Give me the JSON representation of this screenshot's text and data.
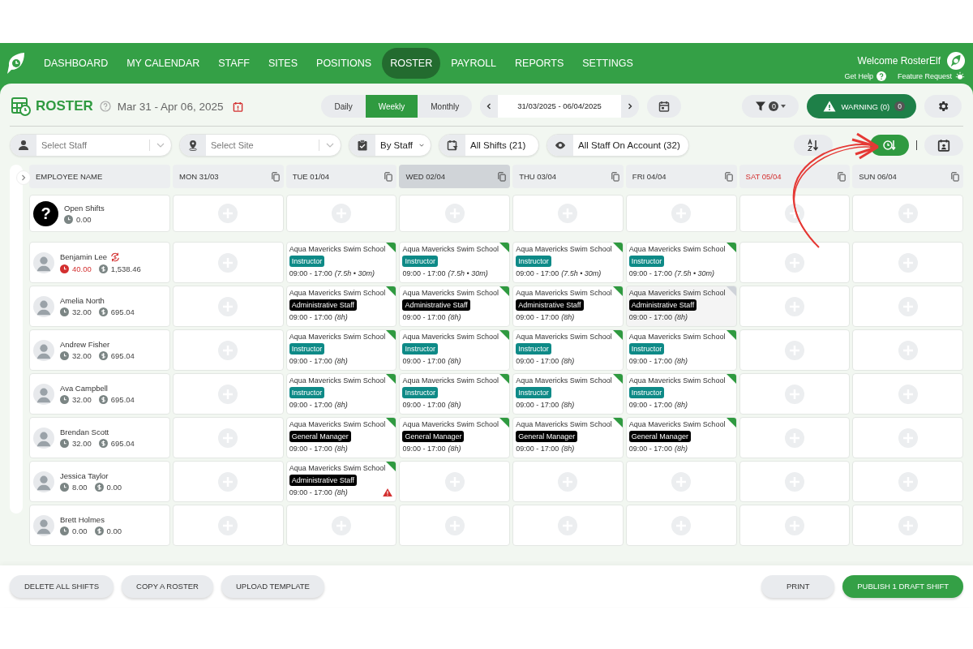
{
  "nav": {
    "items": [
      {
        "label": "DASHBOARD",
        "selected": false
      },
      {
        "label": "MY CALENDAR",
        "selected": false
      },
      {
        "label": "STAFF",
        "selected": false
      },
      {
        "label": "SITES",
        "selected": false
      },
      {
        "label": "POSITIONS",
        "selected": false
      },
      {
        "label": "ROSTER",
        "selected": true
      },
      {
        "label": "PAYROLL",
        "selected": false
      },
      {
        "label": "REPORTS",
        "selected": false
      },
      {
        "label": "SETTINGS",
        "selected": false
      }
    ],
    "welcome": "Welcome RosterElf",
    "help": "Get Help",
    "feature": "Feature Request"
  },
  "header": {
    "title": "ROSTER",
    "date_range": "Mar 31 - Apr 06, 2025",
    "views": [
      {
        "label": "Daily",
        "selected": false
      },
      {
        "label": "Weekly",
        "selected": true
      },
      {
        "label": "Monthly",
        "selected": false
      }
    ],
    "date_field": "31/03/2025 - 06/04/2025",
    "filter_count": "0",
    "warning": "WARNING (0)",
    "warning_count": "0"
  },
  "filters": {
    "staff_placeholder": "Select Staff",
    "site_placeholder": "Select Site",
    "group_by": "By Staff",
    "shifts": "All Shifts (21)",
    "scope": "All Staff On Account (32)",
    "sort_buttons": [
      {
        "kind": "alpha",
        "selected": false
      },
      {
        "kind": "time",
        "selected": true
      }
    ]
  },
  "grid": {
    "first_column": "EMPLOYEE NAME",
    "days": [
      {
        "label": "MON 31/03",
        "today": false,
        "weekend": false
      },
      {
        "label": "TUE 01/04",
        "today": false,
        "weekend": false
      },
      {
        "label": "WED 02/04",
        "today": true,
        "weekend": false
      },
      {
        "label": "THU 03/04",
        "today": false,
        "weekend": false
      },
      {
        "label": "FRI 04/04",
        "today": false,
        "weekend": false
      },
      {
        "label": "SAT 05/04",
        "today": false,
        "weekend": true
      },
      {
        "label": "SUN 06/04",
        "today": false,
        "weekend": false
      }
    ],
    "open_shifts": {
      "badge": "?",
      "name": "Open Shifts",
      "hours": "0.00"
    },
    "employees": [
      {
        "name": "Benjamin Lee",
        "hours": "40.00",
        "cost": "1,538.46",
        "over": true,
        "shifts": [
          {
            "kind": "empty"
          },
          {
            "kind": "shift",
            "site": "Aqua Mavericks Swim School",
            "role": "Instructor",
            "color": "#0e8a87",
            "time": "09:00 - 17:00",
            "duration": "(7.5h • 30m)",
            "published": true,
            "warning": false
          },
          {
            "kind": "shift",
            "site": "Aqua Mavericks Swim School",
            "role": "Instructor",
            "color": "#0e8a87",
            "time": "09:00 - 17:00",
            "duration": "(7.5h • 30m)",
            "published": true,
            "warning": false
          },
          {
            "kind": "shift",
            "site": "Aqua Mavericks Swim School",
            "role": "Instructor",
            "color": "#0e8a87",
            "time": "09:00 - 17:00",
            "duration": "(7.5h • 30m)",
            "published": true,
            "warning": false
          },
          {
            "kind": "shift",
            "site": "Aqua Mavericks Swim School",
            "role": "Instructor",
            "color": "#0e8a87",
            "time": "09:00 - 17:00",
            "duration": "(7.5h • 30m)",
            "published": true,
            "warning": false
          },
          {
            "kind": "empty"
          },
          {
            "kind": "empty"
          }
        ]
      },
      {
        "name": "Amelia North",
        "hours": "32.00",
        "cost": "695.04",
        "over": false,
        "shifts": [
          {
            "kind": "empty"
          },
          {
            "kind": "shift",
            "site": "Aqua Mavericks Swim School",
            "role": "Administrative Staff",
            "color": "#000000",
            "time": "09:00 - 17:00",
            "duration": "(8h)",
            "published": true,
            "warning": false
          },
          {
            "kind": "shift",
            "site": "Aqua Mavericks Swim School",
            "role": "Administrative Staff",
            "color": "#000000",
            "time": "09:00 - 17:00",
            "duration": "(8h)",
            "published": true,
            "warning": false
          },
          {
            "kind": "shift",
            "site": "Aqua Mavericks Swim School",
            "role": "Administrative Staff",
            "color": "#000000",
            "time": "09:00 - 17:00",
            "duration": "(8h)",
            "published": true,
            "warning": false
          },
          {
            "kind": "shift",
            "site": "Aqua Mavericks Swim School",
            "role": "Administrative Staff",
            "color": "#000000",
            "time": "09:00 - 17:00",
            "duration": "(8h)",
            "published": false,
            "warning": false
          },
          {
            "kind": "empty"
          },
          {
            "kind": "empty"
          }
        ]
      },
      {
        "name": "Andrew Fisher",
        "hours": "32.00",
        "cost": "695.04",
        "over": false,
        "shifts": [
          {
            "kind": "empty"
          },
          {
            "kind": "shift",
            "site": "Aqua Mavericks Swim School",
            "role": "Instructor",
            "color": "#0e8a87",
            "time": "09:00 - 17:00",
            "duration": "(8h)",
            "published": true,
            "warning": false
          },
          {
            "kind": "shift",
            "site": "Aqua Mavericks Swim School",
            "role": "Instructor",
            "color": "#0e8a87",
            "time": "09:00 - 17:00",
            "duration": "(8h)",
            "published": true,
            "warning": false
          },
          {
            "kind": "shift",
            "site": "Aqua Mavericks Swim School",
            "role": "Instructor",
            "color": "#0e8a87",
            "time": "09:00 - 17:00",
            "duration": "(8h)",
            "published": true,
            "warning": false
          },
          {
            "kind": "shift",
            "site": "Aqua Mavericks Swim School",
            "role": "Instructor",
            "color": "#0e8a87",
            "time": "09:00 - 17:00",
            "duration": "(8h)",
            "published": true,
            "warning": false
          },
          {
            "kind": "empty"
          },
          {
            "kind": "empty"
          }
        ]
      },
      {
        "name": "Ava Campbell",
        "hours": "32.00",
        "cost": "695.04",
        "over": false,
        "shifts": [
          {
            "kind": "empty"
          },
          {
            "kind": "shift",
            "site": "Aqua Mavericks Swim School",
            "role": "Instructor",
            "color": "#0e8a87",
            "time": "09:00 - 17:00",
            "duration": "(8h)",
            "published": true,
            "warning": false
          },
          {
            "kind": "shift",
            "site": "Aqua Mavericks Swim School",
            "role": "Instructor",
            "color": "#0e8a87",
            "time": "09:00 - 17:00",
            "duration": "(8h)",
            "published": true,
            "warning": false
          },
          {
            "kind": "shift",
            "site": "Aqua Mavericks Swim School",
            "role": "Instructor",
            "color": "#0e8a87",
            "time": "09:00 - 17:00",
            "duration": "(8h)",
            "published": true,
            "warning": false
          },
          {
            "kind": "shift",
            "site": "Aqua Mavericks Swim School",
            "role": "Instructor",
            "color": "#0e8a87",
            "time": "09:00 - 17:00",
            "duration": "(8h)",
            "published": true,
            "warning": false
          },
          {
            "kind": "empty"
          },
          {
            "kind": "empty"
          }
        ]
      },
      {
        "name": "Brendan Scott",
        "hours": "32.00",
        "cost": "695.04",
        "over": false,
        "shifts": [
          {
            "kind": "empty"
          },
          {
            "kind": "shift",
            "site": "Aqua Mavericks Swim School",
            "role": "General Manager",
            "color": "#000000",
            "time": "09:00 - 17:00",
            "duration": "(8h)",
            "published": true,
            "warning": false
          },
          {
            "kind": "shift",
            "site": "Aqua Mavericks Swim School",
            "role": "General Manager",
            "color": "#000000",
            "time": "09:00 - 17:00",
            "duration": "(8h)",
            "published": true,
            "warning": false
          },
          {
            "kind": "shift",
            "site": "Aqua Mavericks Swim School",
            "role": "General Manager",
            "color": "#000000",
            "time": "09:00 - 17:00",
            "duration": "(8h)",
            "published": true,
            "warning": false
          },
          {
            "kind": "shift",
            "site": "Aqua Mavericks Swim School",
            "role": "General Manager",
            "color": "#000000",
            "time": "09:00 - 17:00",
            "duration": "(8h)",
            "published": true,
            "warning": false
          },
          {
            "kind": "empty"
          },
          {
            "kind": "empty"
          }
        ]
      },
      {
        "name": "Jessica Taylor",
        "hours": "8.00",
        "cost": "0.00",
        "over": false,
        "shifts": [
          {
            "kind": "empty"
          },
          {
            "kind": "shift",
            "site": "Aqua Mavericks Swim School",
            "role": "Administrative Staff",
            "color": "#000000",
            "time": "09:00 - 17:00",
            "duration": "(8h)",
            "published": true,
            "warning": true
          },
          {
            "kind": "empty"
          },
          {
            "kind": "empty"
          },
          {
            "kind": "empty"
          },
          {
            "kind": "empty"
          },
          {
            "kind": "empty"
          }
        ]
      },
      {
        "name": "Brett Holmes",
        "hours": "0.00",
        "cost": "0.00",
        "over": false,
        "shifts": [
          {
            "kind": "empty"
          },
          {
            "kind": "empty"
          },
          {
            "kind": "empty"
          },
          {
            "kind": "empty"
          },
          {
            "kind": "empty"
          },
          {
            "kind": "empty"
          },
          {
            "kind": "empty"
          }
        ]
      }
    ]
  },
  "footer": {
    "left": [
      "DELETE ALL SHIFTS",
      "COPY A ROSTER",
      "UPLOAD TEMPLATE"
    ],
    "right": [
      {
        "label": "PRINT",
        "kind": "plain"
      },
      {
        "label": "PUBLISH 1 DRAFT SHIFT",
        "kind": "primary"
      }
    ]
  }
}
